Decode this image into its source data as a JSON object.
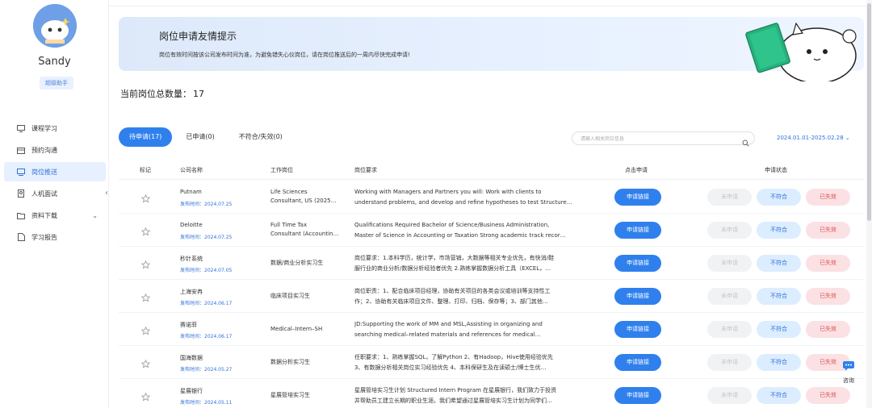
{
  "user": {
    "name": "Sandy",
    "badge": "超级助手"
  },
  "sidebar": {
    "items": [
      {
        "label": "课程学习",
        "icon": "course-icon"
      },
      {
        "label": "预约沟通",
        "icon": "calendar-icon"
      },
      {
        "label": "岗位推送",
        "icon": "job-push-icon",
        "active": true
      },
      {
        "label": "人机面试",
        "icon": "interview-icon"
      },
      {
        "label": "资料下载",
        "icon": "folder-icon",
        "has_submenu": true
      },
      {
        "label": "学习报告",
        "icon": "report-icon"
      }
    ]
  },
  "banner": {
    "title": "岗位申请友情提示",
    "desc": "岗位有效时间按该公司发布时间为准，为避免错失心仪岗位，请在岗位推送后的一周内尽快完成申请!"
  },
  "summary": {
    "label": "当前岗位总数量：",
    "count": "17"
  },
  "tabs": [
    {
      "label": "待申请(17)",
      "active": true
    },
    {
      "label": "已申请(0)"
    },
    {
      "label": "不符合/失效(0)"
    }
  ],
  "search": {
    "placeholder": "请输入相关岗位信息"
  },
  "date_range": "2024.01.01-2025.02.28",
  "table": {
    "headers": {
      "mark": "标记",
      "company": "公司名称",
      "position": "工作岗位",
      "requirements": "岗位要求",
      "apply": "点击申请",
      "status": "申请状态"
    },
    "apply_label": "申请链接",
    "status_labels": {
      "none": "未申请",
      "unfit": "不符合",
      "invalid": "已失效"
    },
    "rows": [
      {
        "company": "Putnam",
        "date": "发布时间：2024.07.25",
        "position": [
          "Life Sciences",
          "Consultant, US (2025…"
        ],
        "req": [
          "Working with Managers and Partners you will: Work with clients to",
          "understand problems, and develop and refine hypotheses to test Structure…"
        ]
      },
      {
        "company": "Deloitte",
        "date": "发布时间：2024.07.25",
        "position": [
          "Full Time Tax",
          "Consultant (Accountin…"
        ],
        "req": [
          "Qualifications Required Bachelor of Science/Business Administration,",
          "Master of Science in Accounting or Taxation Strong academic track recor…"
        ]
      },
      {
        "company": "秒针系统",
        "date": "发布时间：2024.07.05",
        "position": [
          "数据/商业分析实习生"
        ],
        "req": [
          "岗位要求：1.本科学历，统计学，市场营销，大数据等相关专业优先，有快消/鞋",
          "服行业的商业分析/数据分析经验者优先 2.熟练掌握数据分析工具（EXCEL，…"
        ]
      },
      {
        "company": "上海安冉",
        "date": "发布时间：2024.06.17",
        "position": [
          "临床项目实习生"
        ],
        "req": [
          "岗位职责：1、配合临床项目经理，协助有关项目的各类会议或培训等支持性工",
          "作；2、协助有关临床项目文件、整理、打印、归档、保存等；3、部门其他…"
        ]
      },
      {
        "company": "赛诺菲",
        "date": "发布时间：2024.06.17",
        "position": [
          "Medical–Intern–SH"
        ],
        "req": [
          "JD:Supporting the work of MM and MSL,Assisting in organizing and",
          "searching medical–related materials and references for medical…"
        ]
      },
      {
        "company": "国海数据",
        "date": "发布时间：2024.05.27",
        "position": [
          "数据分析实习生"
        ],
        "req": [
          "任职要求：1、熟练掌握SQL，了解Python 2、有Hadoop，Hive使用经验优先",
          "3、有数据分析相关岗位实习经验优先 4、本科保研生及在读硕士/博士生优…"
        ]
      },
      {
        "company": "星展银行",
        "date": "发布时间：2024.05.11",
        "position": [
          "星展管培实习生"
        ],
        "req": [
          "星展管培实习生计划 Structured Intern Program 在星展银行，我们致力于投资",
          "并帮助员工建立长期的职业生涯。我们希望通过星展管培实习生计划为同学们…"
        ]
      }
    ]
  },
  "consult": {
    "label": "咨询"
  }
}
